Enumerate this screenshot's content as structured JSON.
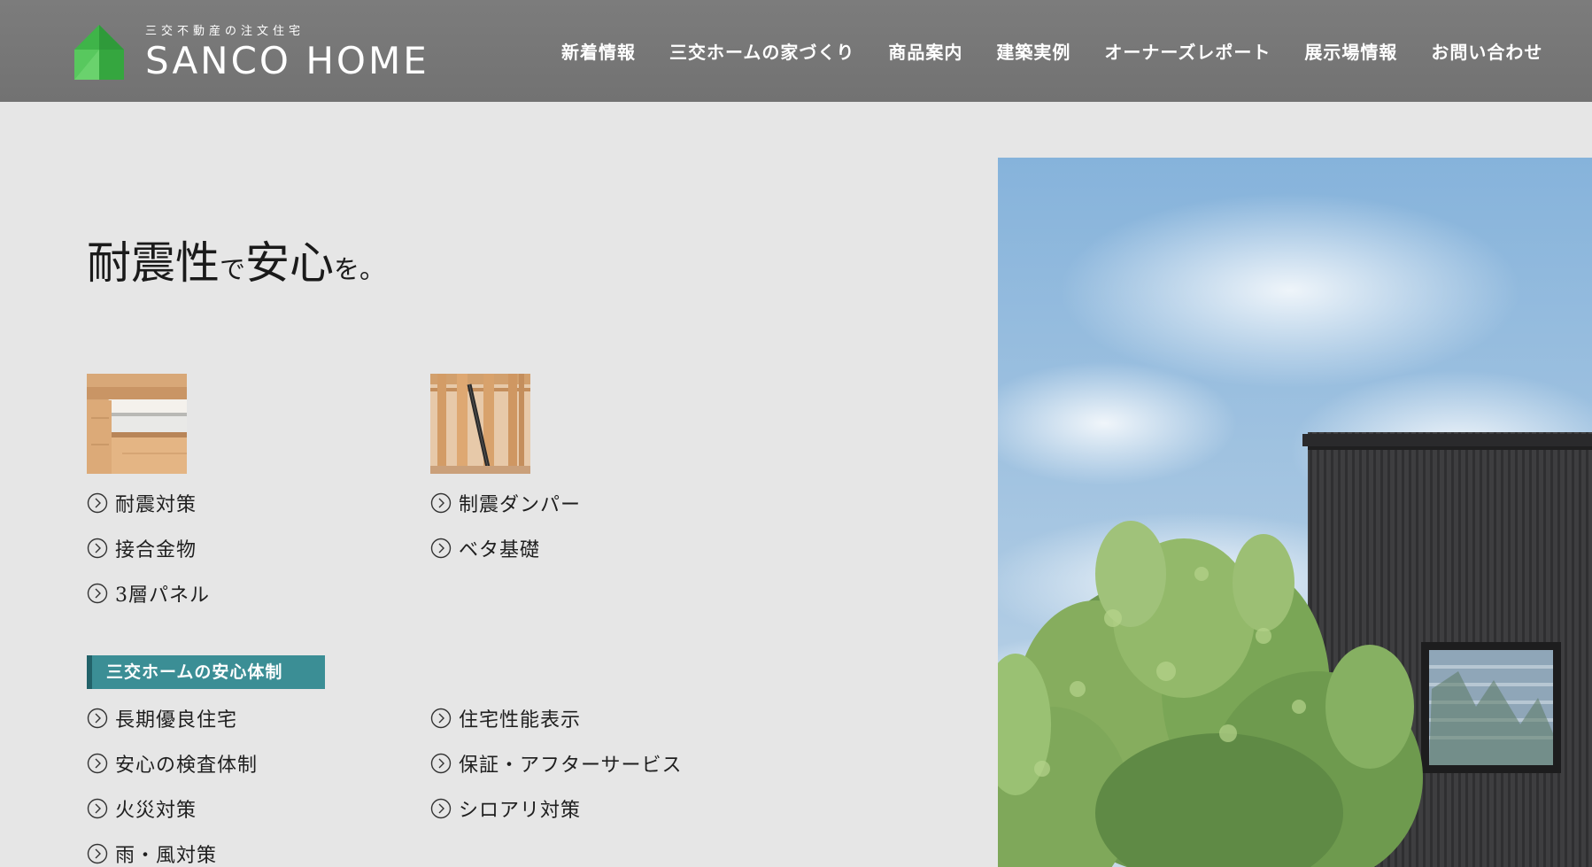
{
  "header": {
    "logo_sub": "三交不動産の注文住宅",
    "logo_name": "SANCO HOME",
    "nav": [
      "新着情報",
      "三交ホームの家づくり",
      "商品案内",
      "建築実例",
      "オーナーズレポート",
      "展示場情報",
      "お問い合わせ"
    ]
  },
  "hero": {
    "headline_part1": "耐震性",
    "headline_part2": "で",
    "headline_part3": "安心",
    "headline_part4": "を。"
  },
  "links": {
    "col1": [
      "耐震対策",
      "接合金物",
      "3層パネル"
    ],
    "col2": [
      "制震ダンパー",
      "ベタ基礎"
    ]
  },
  "section": {
    "badge": "三交ホームの安心体制",
    "col1": [
      "長期優良住宅",
      "安心の検査体制",
      "火災対策",
      "雨・風対策"
    ],
    "col2": [
      "住宅性能表示",
      "保証・アフターサービス",
      "シロアリ対策"
    ]
  },
  "colors": {
    "header_bg": "#767676",
    "page_bg": "#e6e6e6",
    "badge_bg": "#3b8e95",
    "logo_green": "#3fb449"
  },
  "icons": {
    "logo": "house-diamond-logo",
    "link_marker": "chevron-circle-icon"
  }
}
